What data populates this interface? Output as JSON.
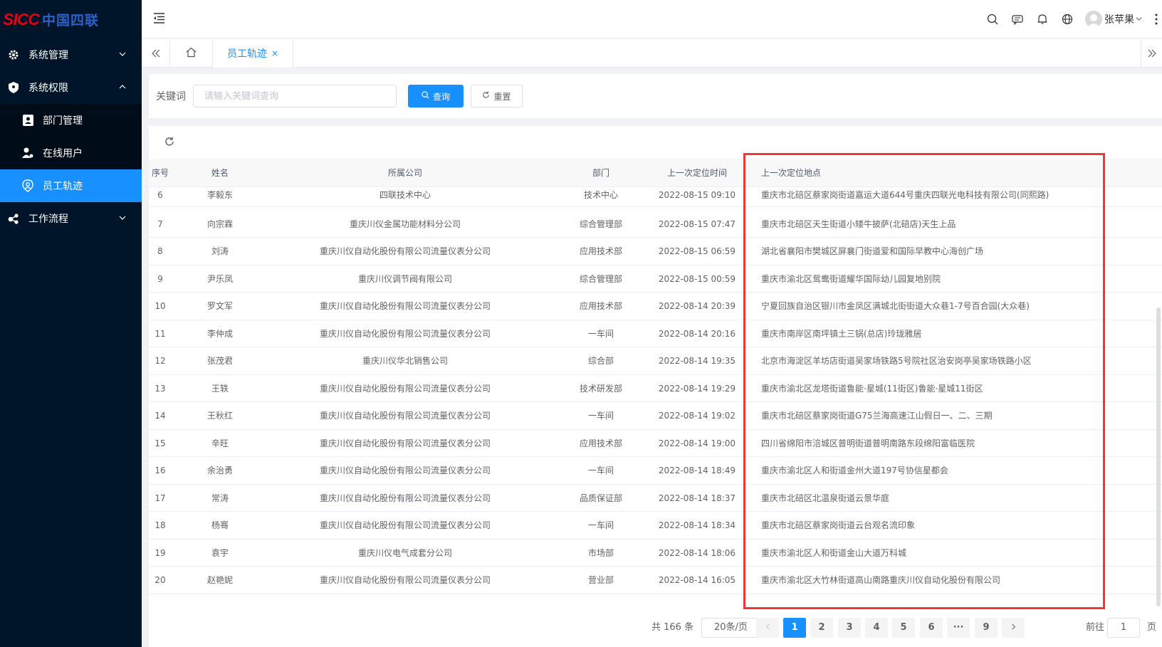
{
  "logo": {
    "brand": "SICC",
    "cn": "中国四联"
  },
  "sidebar": {
    "items": [
      {
        "label": "系统管理"
      },
      {
        "label": "系统权限"
      },
      {
        "label": "工作流程"
      }
    ],
    "sub": [
      {
        "label": "部门管理"
      },
      {
        "label": "在线用户"
      },
      {
        "label": "员工轨迹"
      }
    ]
  },
  "header": {
    "username": "张苹果"
  },
  "tabs": {
    "active_label": "员工轨迹",
    "close": "×"
  },
  "search": {
    "label": "关键词",
    "placeholder": "请输入关键词查询",
    "value": "",
    "query_label": "查询",
    "reset_label": "重置"
  },
  "table": {
    "headers": [
      "序号",
      "姓名",
      "所属公司",
      "部门",
      "上一次定位时间",
      "上一次定位地点"
    ],
    "rows": [
      [
        "6",
        "李毅东",
        "四联技术中心",
        "技术中心",
        "2022-08-15 09:10",
        "重庆市北碚区蔡家岗街道嘉运大道644号重庆四联光电科技有限公司(同熙路)"
      ],
      [
        "7",
        "向宗霖",
        "重庆川仪金属功能材料分公司",
        "综合管理部",
        "2022-08-15 07:47",
        "重庆市北碚区天生街道小矮牛披萨(北碚店)天生上品"
      ],
      [
        "8",
        "刘涛",
        "重庆川仪自动化股份有限公司流量仪表分公司",
        "应用技术部",
        "2022-08-15 06:59",
        "湖北省襄阳市樊城区屏襄门街道爱和国际早教中心海创广场"
      ],
      [
        "9",
        "尹乐凤",
        "重庆川仪调节阀有限公司",
        "综合管理部",
        "2022-08-15 00:59",
        "重庆市渝北区鸳鸯街道耀华国际幼儿园复地别院"
      ],
      [
        "10",
        "罗文军",
        "重庆川仪自动化股份有限公司流量仪表分公司",
        "应用技术部",
        "2022-08-14 20:39",
        "宁夏回族自治区银川市金凤区满城北街街道大众巷1-7号百合园(大众巷)"
      ],
      [
        "11",
        "李仲成",
        "重庆川仪自动化股份有限公司流量仪表分公司",
        "一车间",
        "2022-08-14 20:16",
        "重庆市南岸区南坪镇土三锅(总店)玲珑雅居"
      ],
      [
        "12",
        "张茂君",
        "重庆川仪华北销售公司",
        "综合部",
        "2022-08-14 19:35",
        "北京市海淀区羊坊店街道吴家场铁路5号院社区治安岗亭吴家场铁路小区"
      ],
      [
        "13",
        "王轶",
        "重庆川仪自动化股份有限公司流量仪表分公司",
        "技术研发部",
        "2022-08-14 19:29",
        "重庆市渝北区龙塔街道鲁能·星城(11街区)鲁能·星城11街区"
      ],
      [
        "14",
        "王秋红",
        "重庆川仪自动化股份有限公司流量仪表分公司",
        "一车间",
        "2022-08-14 19:02",
        "重庆市北碚区蔡家岗街道G75兰海高速江山假日一、二、三期"
      ],
      [
        "15",
        "辛旺",
        "重庆川仪自动化股份有限公司流量仪表分公司",
        "应用技术部",
        "2022-08-14 19:00",
        "四川省绵阳市涪城区普明街道普明南路东段绵阳富临医院"
      ],
      [
        "16",
        "余治勇",
        "重庆川仪自动化股份有限公司流量仪表分公司",
        "一车间",
        "2022-08-14 18:49",
        "重庆市渝北区人和街道金州大道197号协信星都会"
      ],
      [
        "17",
        "常涛",
        "重庆川仪自动化股份有限公司流量仪表分公司",
        "品质保证部",
        "2022-08-14 18:37",
        "重庆市北碚区北温泉街道云景华庭"
      ],
      [
        "18",
        "杨骞",
        "重庆川仪自动化股份有限公司流量仪表分公司",
        "一车间",
        "2022-08-14 18:34",
        "重庆市北碚区蔡家岗街道云台观名流印象"
      ],
      [
        "19",
        "袁宇",
        "重庆川仪电气成套分公司",
        "市场部",
        "2022-08-14 18:06",
        "重庆市渝北区人和街道金山大道万科城"
      ],
      [
        "20",
        "赵艳妮",
        "重庆川仪自动化股份有限公司流量仪表分公司",
        "营业部",
        "2022-08-14 16:05",
        "重庆市渝北区大竹林街道高山南路重庆川仪自动化股份有限公司"
      ]
    ]
  },
  "pagination": {
    "total": "共 166 条",
    "page_size": "20条/页",
    "pages": [
      "1",
      "2",
      "3",
      "4",
      "5",
      "6",
      "···",
      "9"
    ],
    "current": "1",
    "goto_label": "前往",
    "goto_value": "1",
    "goto_suffix": "页"
  },
  "colors": {
    "accent": "#1890ff",
    "sidebar": "#001529",
    "highlight": "#ee3737"
  }
}
